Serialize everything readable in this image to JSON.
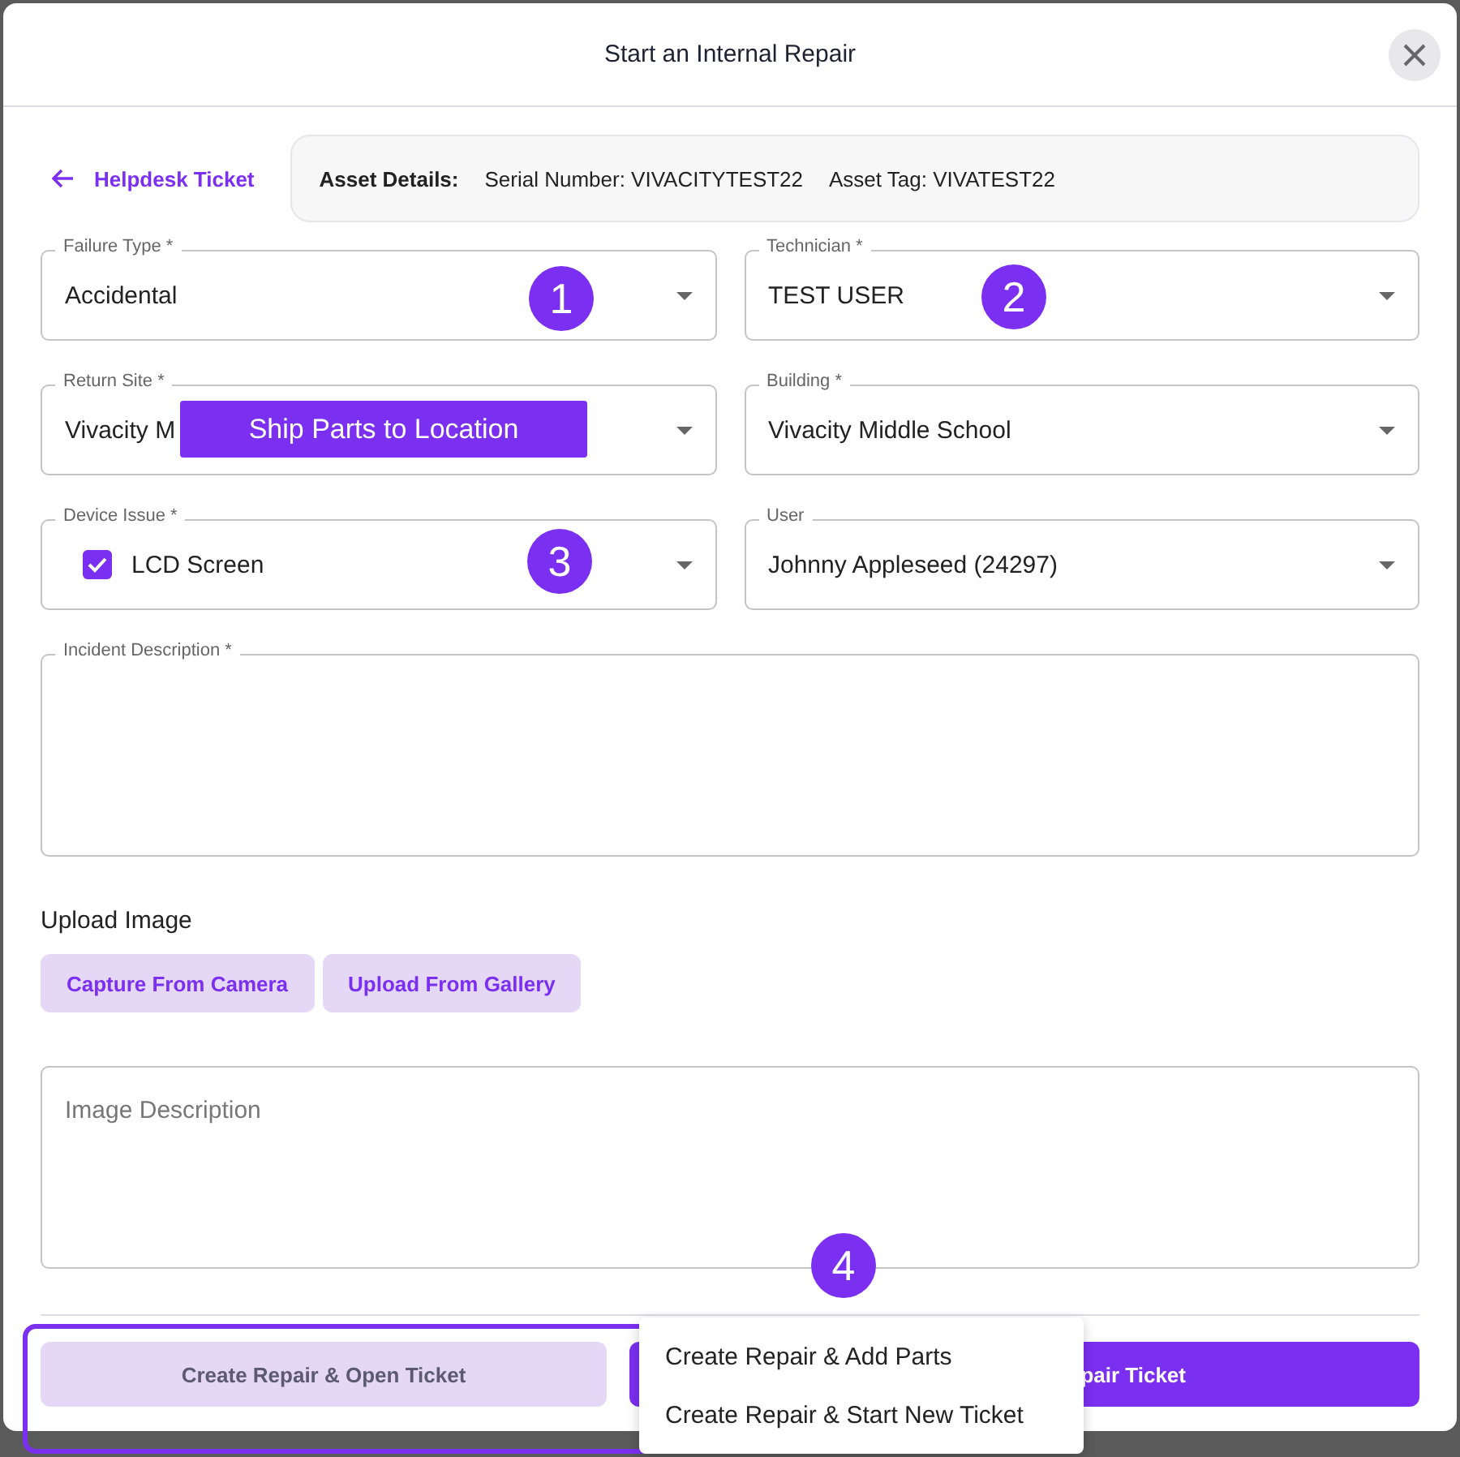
{
  "dialog": {
    "title": "Start an Internal Repair"
  },
  "back_link": {
    "label": "Helpdesk Ticket"
  },
  "asset_details": {
    "label": "Asset Details:",
    "serial": "Serial Number: VIVACITYTEST22",
    "tag": "Asset Tag: VIVATEST22"
  },
  "fields": [
    {
      "kind": "select",
      "label": "Failure Type *",
      "value": "Accidental"
    },
    {
      "kind": "select",
      "label": "Technician *",
      "value": "TEST USER"
    },
    {
      "kind": "select",
      "label": "Return Site *",
      "value": "Vivacity M"
    },
    {
      "kind": "select",
      "label": "Building *",
      "value": "Vivacity Middle School"
    },
    {
      "kind": "checkbox",
      "label": "Device Issue *",
      "value": "LCD Screen",
      "checked": true
    },
    {
      "kind": "select",
      "label": "User",
      "value": "Johnny Appleseed (24297)"
    }
  ],
  "incident_description": {
    "label": "Incident Description *"
  },
  "upload": {
    "label": "Upload Image",
    "buttons": [
      "Capture From Camera",
      "Upload From Gallery"
    ]
  },
  "image_description": {
    "placeholder": "Image Description"
  },
  "footer_buttons": [
    {
      "kind": "secondary",
      "label": "Create Repair & Open Ticket"
    },
    {
      "kind": "primary",
      "label": "pair Ticket"
    }
  ],
  "menu": {
    "items": [
      "Create Repair & Add Parts",
      "Create Repair & Start New Ticket"
    ]
  },
  "annotations": {
    "badges": [
      "1",
      "2",
      "3",
      "4"
    ],
    "callout": "Ship Parts to Location"
  }
}
